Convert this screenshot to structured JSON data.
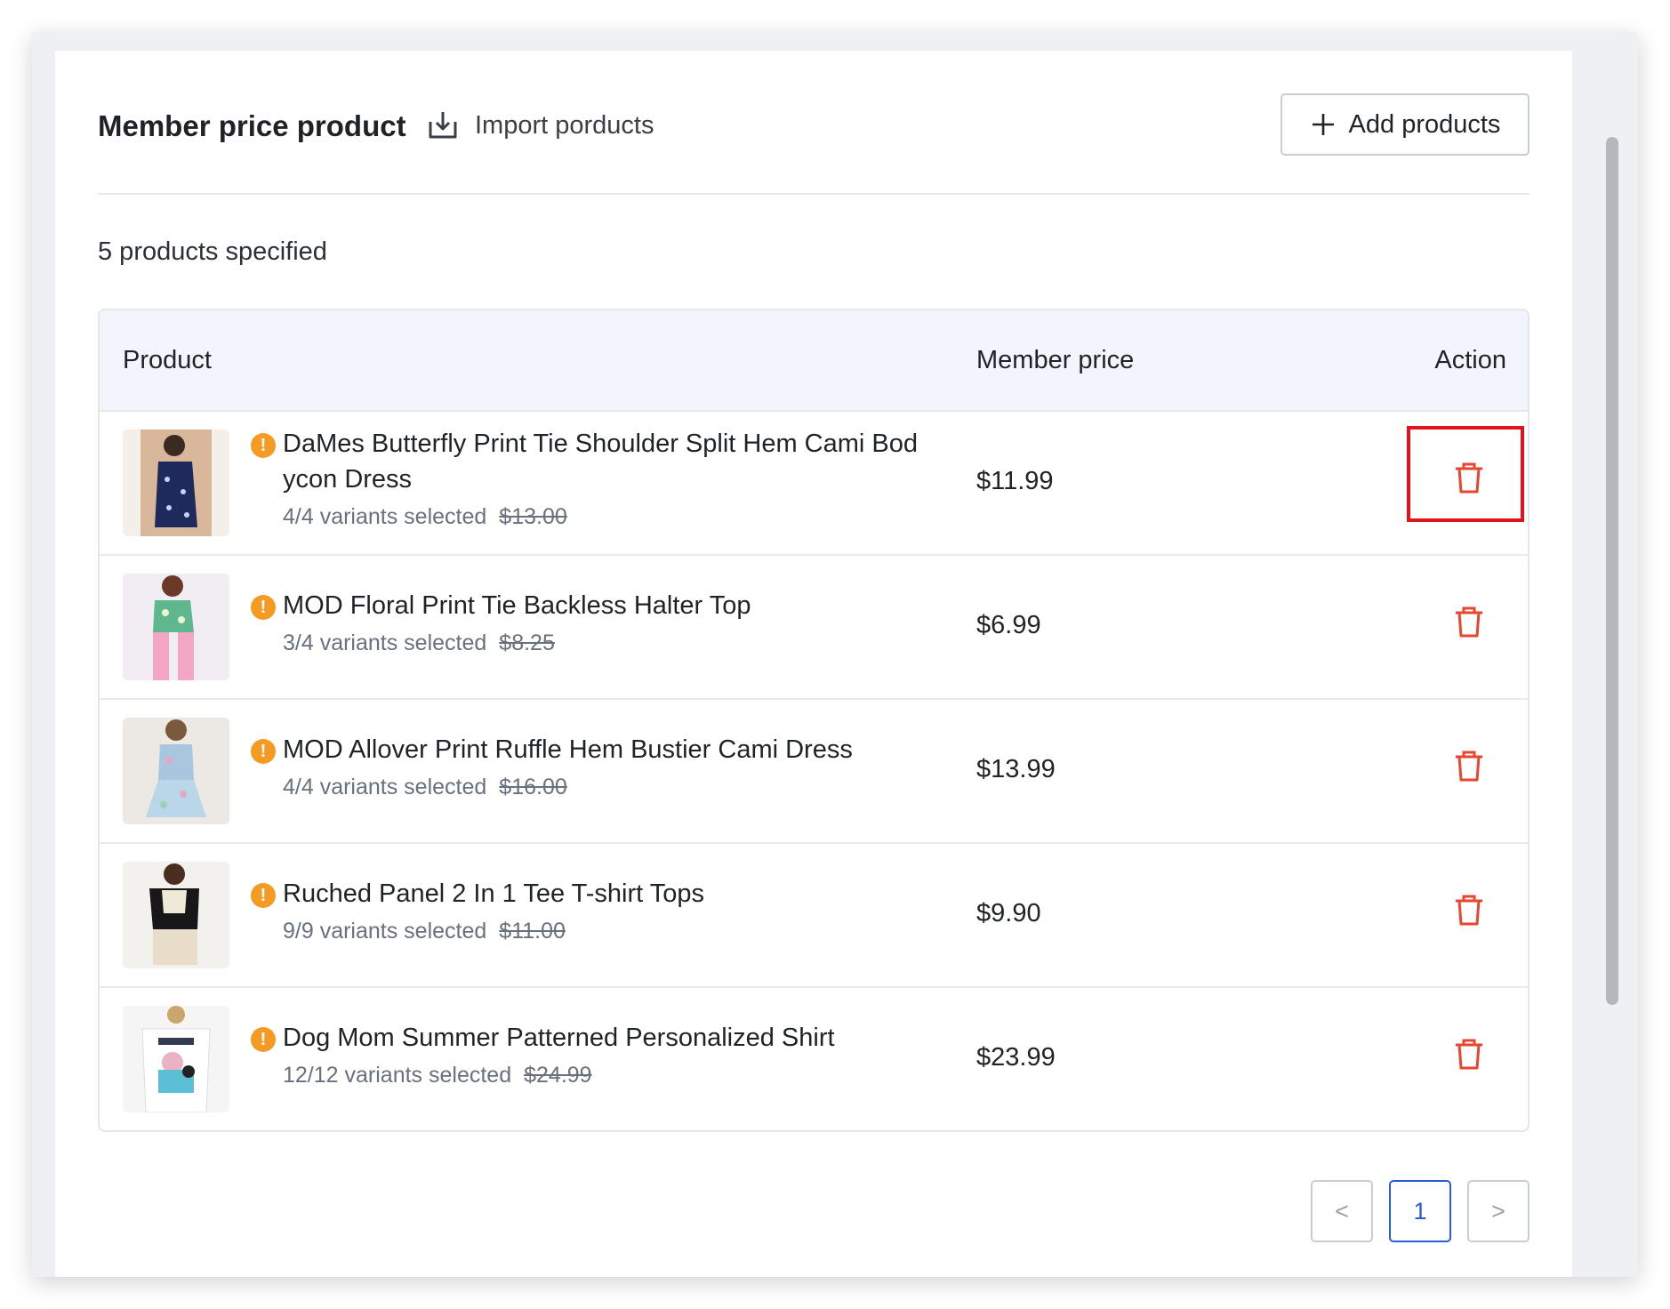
{
  "header": {
    "title": "Member price product",
    "import_label": "Import porducts",
    "add_label": "Add products"
  },
  "summary": {
    "count_text": "5 products specified"
  },
  "table": {
    "columns": {
      "product": "Product",
      "member_price": "Member price",
      "action": "Action"
    },
    "rows": [
      {
        "name": "DaMes Butterfly Print Tie Shoulder Split Hem Cami Bod ycon Dress",
        "variants": "4/4 variants selected",
        "original_price": "$13.00",
        "member_price": "$11.99"
      },
      {
        "name": "MOD Floral Print Tie Backless Halter Top",
        "variants": "3/4 variants selected",
        "original_price": "$8.25",
        "member_price": "$6.99"
      },
      {
        "name": "MOD Allover Print Ruffle Hem Bustier Cami Dress",
        "variants": "4/4 variants selected",
        "original_price": "$16.00",
        "member_price": "$13.99"
      },
      {
        "name": "Ruched Panel 2 In 1 Tee T-shirt Tops",
        "variants": "9/9 variants selected",
        "original_price": "$11.00",
        "member_price": "$9.90"
      },
      {
        "name": "Dog Mom Summer Patterned Personalized Shirt",
        "variants": "12/12 variants selected",
        "original_price": "$24.99",
        "member_price": "$23.99"
      }
    ]
  },
  "pagination": {
    "prev": "<",
    "current": "1",
    "next": ">"
  },
  "colors": {
    "warning": "#f59a23",
    "delete": "#e8462f",
    "highlight": "#e0131f",
    "active_page": "#2b5bd7"
  }
}
